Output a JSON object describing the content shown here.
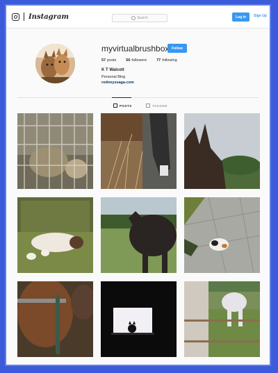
{
  "header": {
    "wordmark": "Instagram",
    "search_placeholder": "Search",
    "login_label": "Log In",
    "signup_label": "Sign Up",
    "icons": [
      "instagram-glyph-icon",
      "search-icon"
    ]
  },
  "profile": {
    "username": "myvirtualbrushbox",
    "follow_label": "Follow",
    "stats": {
      "posts_count": "57",
      "posts_label": "posts",
      "followers_count": "56",
      "followers_label": "followers",
      "following_count": "77",
      "following_label": "following"
    },
    "full_name": "K T Walcott",
    "bio": "Personal Blog",
    "website": "rodneyssaga.com"
  },
  "tabs": {
    "posts_label": "POSTS",
    "tagged_label": "TAGGED"
  },
  "colors": {
    "accent": "#3897f0",
    "link": "#003569",
    "page_border": "#3b5bdb"
  },
  "posts": [
    {
      "subject": "cats in cage"
    },
    {
      "subject": "horse leg with hay"
    },
    {
      "subject": "horse ears silhouette"
    },
    {
      "subject": "siamese cat on chair"
    },
    {
      "subject": "dark horse in field"
    },
    {
      "subject": "calico cat on pavement"
    },
    {
      "subject": "horse head with halter"
    },
    {
      "subject": "cat at window"
    },
    {
      "subject": "white horse at fence"
    }
  ]
}
